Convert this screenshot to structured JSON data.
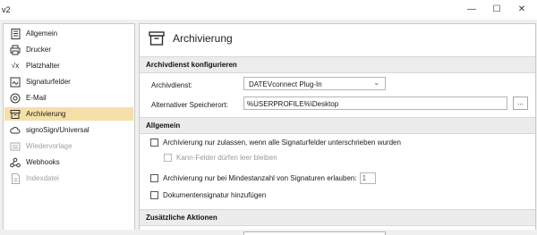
{
  "window": {
    "title": "v2",
    "controls": {
      "minimize": "—",
      "maximize": "☐",
      "close": "✕"
    }
  },
  "sidebar": {
    "items": [
      {
        "label": "Allgemein",
        "icon": "settings-page-icon",
        "state": "normal"
      },
      {
        "label": "Drucker",
        "icon": "printer-icon",
        "state": "normal"
      },
      {
        "label": "Platzhalter",
        "icon": "sqrt-x-icon",
        "icon_text": "√x",
        "state": "normal"
      },
      {
        "label": "Signaturfelder",
        "icon": "signature-field-icon",
        "state": "normal"
      },
      {
        "label": "E-Mail",
        "icon": "email-at-icon",
        "state": "normal"
      },
      {
        "label": "Archivierung",
        "icon": "archive-box-icon",
        "state": "active"
      },
      {
        "label": "signoSign/Universal",
        "icon": "cloud-sync-icon",
        "state": "normal"
      },
      {
        "label": "Wiedervorlage",
        "icon": "resubmission-icon",
        "state": "disabled"
      },
      {
        "label": "Webhooks",
        "icon": "webhooks-icon",
        "state": "normal"
      },
      {
        "label": "Indexdatei",
        "icon": "index-file-icon",
        "state": "disabled"
      }
    ],
    "active_color": "#f6dfa8"
  },
  "main": {
    "title": "Archivierung",
    "sections": {
      "archive_service": {
        "header": "Archivdienst konfigurieren",
        "service_label": "Archivdienst:",
        "service_value": "DATEVconnect Plug-In",
        "path_label": "Alternativer Speicherort:",
        "path_value": "%USERPROFILE%\\Desktop",
        "browse_label": "..."
      },
      "general": {
        "header": "Allgemein",
        "opt_all_signed": "Archivierung nur zulassen, wenn alle Signaturfelder unterschrieben wurden",
        "opt_optional_empty": "Kann-Felder dürfen leer bleiben",
        "opt_min_signatures": "Archivierung nur bei Mindestanzahl von Signaturen erlauben:",
        "min_signatures_value": "1",
        "opt_doc_signature": "Dokumentensignatur hinzufügen"
      },
      "additional": {
        "header": "Zusätzliche Aktionen"
      }
    }
  }
}
